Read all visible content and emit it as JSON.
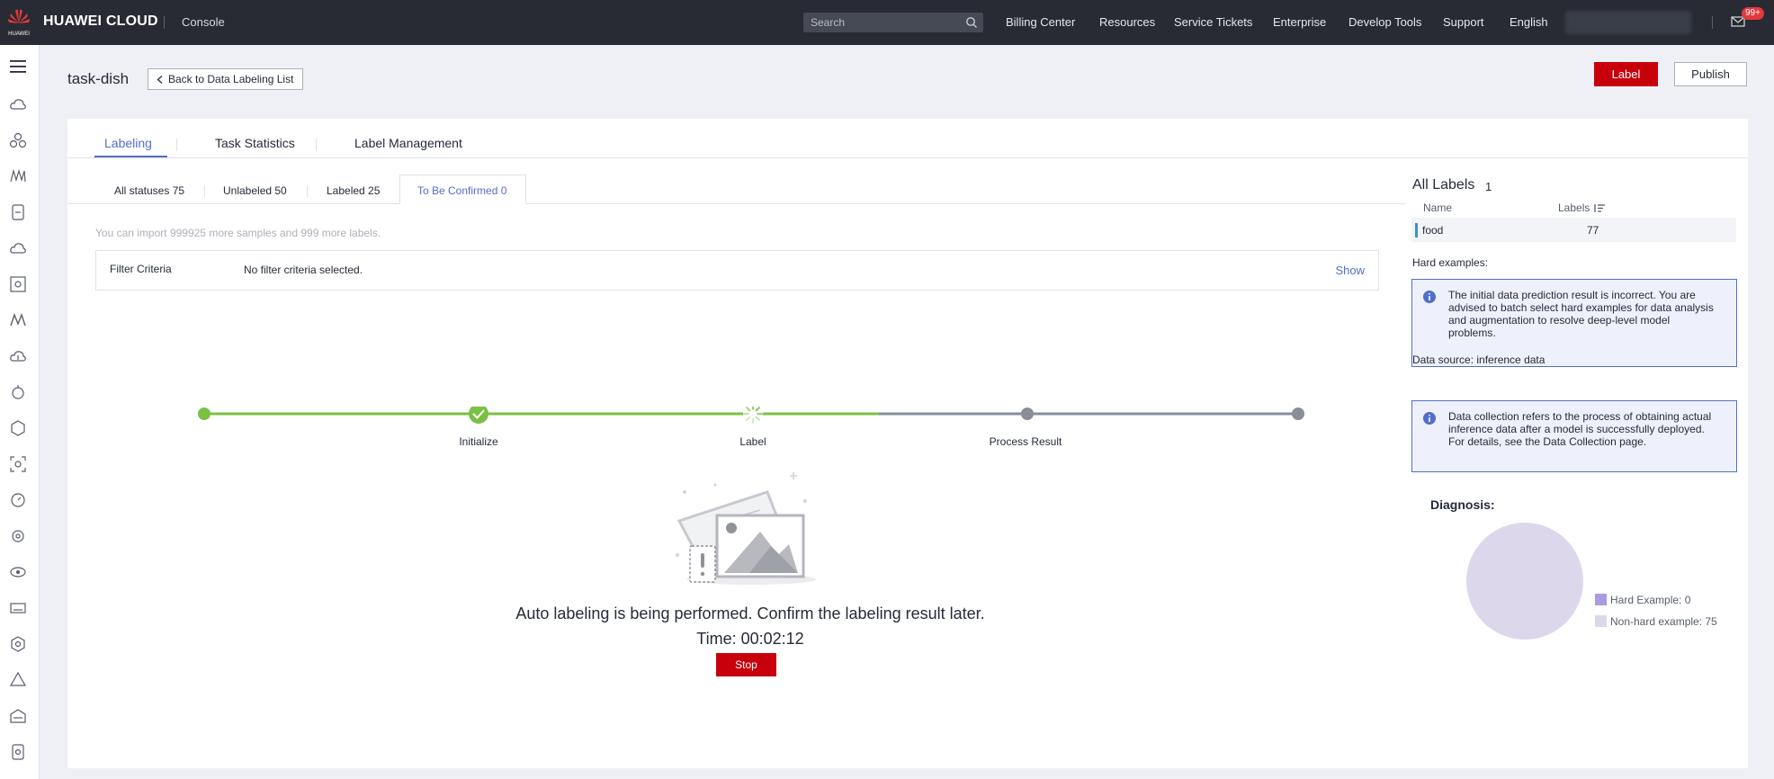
{
  "topbar": {
    "logo_text": "HUAWEI",
    "brand": "HUAWEI CLOUD",
    "console": "Console",
    "search_placeholder": "Search",
    "nav": [
      "Billing Center",
      "Resources",
      "Service Tickets",
      "Enterprise",
      "Develop Tools",
      "Support",
      "English"
    ],
    "badge": "99+"
  },
  "header": {
    "title": "task-dish",
    "back_label": "Back to Data Labeling List",
    "label_button": "Label",
    "publish_button": "Publish"
  },
  "tabs": [
    "Labeling",
    "Task Statistics",
    "Label Management"
  ],
  "subtabs": [
    "All statuses 75",
    "Unlabeled 50",
    "Labeled 25",
    "To Be Confirmed 0"
  ],
  "import_note": "You can import 999925 more samples and 999 more labels.",
  "filter": {
    "label": "Filter Criteria",
    "value": "No filter criteria selected.",
    "show": "Show"
  },
  "progress": {
    "steps": [
      "Initialize",
      "Label",
      "Process Result"
    ]
  },
  "status": {
    "message": "Auto labeling is being performed. Confirm the labeling result later.",
    "time": "Time: 00:02:12",
    "stop": "Stop"
  },
  "right_panel": {
    "title": "All Labels",
    "count": "1",
    "col_name": "Name",
    "col_labels": "Labels",
    "rows": [
      {
        "name": "food",
        "count": "77"
      }
    ],
    "hard_examples_label": "Hard examples:",
    "hard_info": "The initial data prediction result is incorrect. You are advised to batch select hard examples for data analysis and augmentation to resolve deep-level model problems.",
    "data_source": "Data source: inference data",
    "collection_info": "Data collection refers to the process of obtaining actual inference data after a model is successfully deployed. For details, see the Data Collection page.",
    "diagnosis_title": "Diagnosis:",
    "legend_hard": "Hard Example: 0",
    "legend_nonhard": "Non-hard example: 75"
  },
  "colors": {
    "brand_red": "#c7000b",
    "accent_blue": "#526ecc",
    "progress_green": "#7ac143",
    "pie_hard": "#ab9be0",
    "pie_nonhard": "#ddd7ec"
  }
}
